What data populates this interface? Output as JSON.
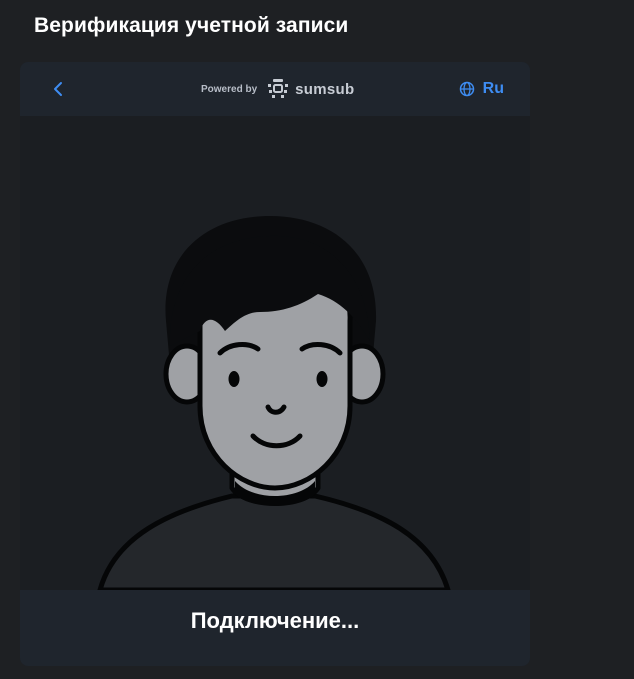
{
  "page": {
    "title": "Верификация учетной записи"
  },
  "header": {
    "back_icon": "chevron-left-icon",
    "powered_by": "Powered by",
    "brand_icon": "sumsub-logo-icon",
    "brand_name": "sumsub",
    "language_icon": "globe-icon",
    "language": "Ru"
  },
  "illustration": {
    "subject": "avatar-face-icon"
  },
  "status": {
    "text": "Подключение..."
  },
  "colors": {
    "background": "#1e2023",
    "card": "#1b1e22",
    "header": "#1f252d",
    "accent": "#3e8df3",
    "skin": "#9fa1a5",
    "hair": "#0b0c0e"
  }
}
